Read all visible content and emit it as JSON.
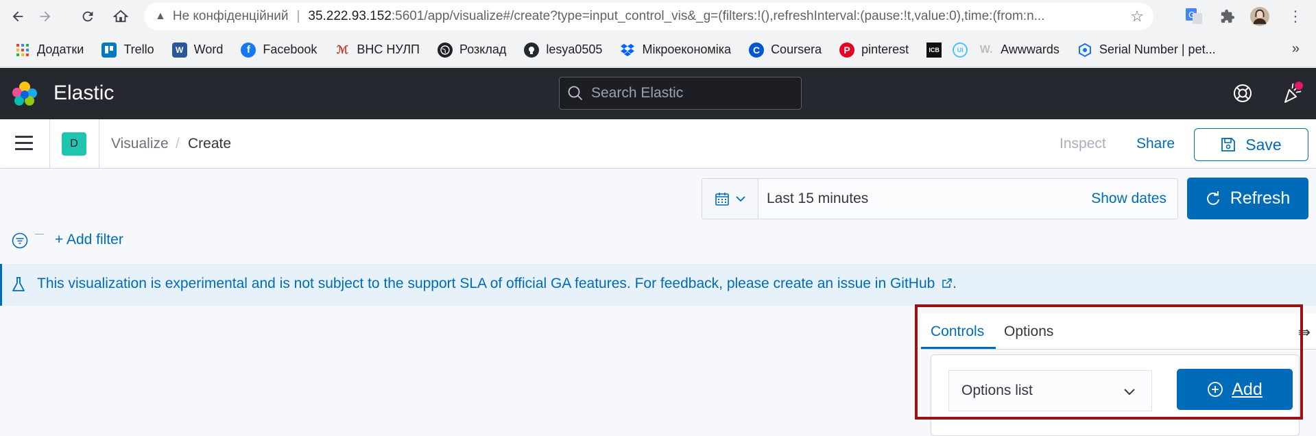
{
  "browser": {
    "not_secure_label": "Не конфіденційний",
    "url_host": "35.222.93.152",
    "url_rest": ":5601/app/visualize#/create?type=input_control_vis&_g=(filters:!(),refreshInterval:(pause:!t,value:0),time:(from:n...",
    "bookmarks": [
      {
        "label": "Додатки",
        "icon": "apps-grid-icon",
        "color": "#ea4335"
      },
      {
        "label": "Trello",
        "icon": "trello-icon",
        "color": "#0079bf"
      },
      {
        "label": "Word",
        "icon": "word-icon",
        "color": "#2b579a"
      },
      {
        "label": "Facebook",
        "icon": "facebook-icon",
        "color": "#1877f2"
      },
      {
        "label": "ВНС НУЛП",
        "icon": "nulp-icon",
        "color": "#c0392b"
      },
      {
        "label": "Розклад",
        "icon": "globe-icon",
        "color": "#202124"
      },
      {
        "label": "lesya0505",
        "icon": "github-icon",
        "color": "#24292e"
      },
      {
        "label": "Мікроекономіка",
        "icon": "dropbox-icon",
        "color": "#0061ff"
      },
      {
        "label": "Coursera",
        "icon": "coursera-icon",
        "color": "#0056d2"
      },
      {
        "label": "pinterest",
        "icon": "pinterest-icon",
        "color": "#e60023"
      },
      {
        "label": "",
        "icon": "icb-icon",
        "color": "#111111"
      },
      {
        "label": "",
        "icon": "ui-icon",
        "color": "#4fc3f7"
      },
      {
        "label": "Awwwards",
        "icon": "awwwards-icon",
        "color": "#cccccc"
      },
      {
        "label": "Serial Number | pet...",
        "icon": "serial-icon",
        "color": "#1a73e8"
      }
    ]
  },
  "header": {
    "title": "Elastic",
    "search_placeholder": "Search Elastic"
  },
  "appbar": {
    "space_initial": "D",
    "breadcrumb_prev": "Visualize",
    "breadcrumb_sep": "/",
    "breadcrumb_current": "Create",
    "inspect": "Inspect",
    "share": "Share",
    "save": "Save"
  },
  "query": {
    "time_range": "Last 15 minutes",
    "show_dates": "Show dates",
    "refresh": "Refresh",
    "add_filter": "+ Add filter"
  },
  "callout": {
    "text": "This visualization is experimental and is not subject to the support SLA of official GA features. For feedback, please create an issue in GitHub",
    "suffix": "."
  },
  "editor": {
    "tabs": [
      "Controls",
      "Options"
    ],
    "control_type": "Options list",
    "add": "Add"
  },
  "colors": {
    "primary": "#006bb8",
    "header_bg": "#25282f",
    "space_avatar": "#20c5b0",
    "highlight": "#9b1214"
  }
}
